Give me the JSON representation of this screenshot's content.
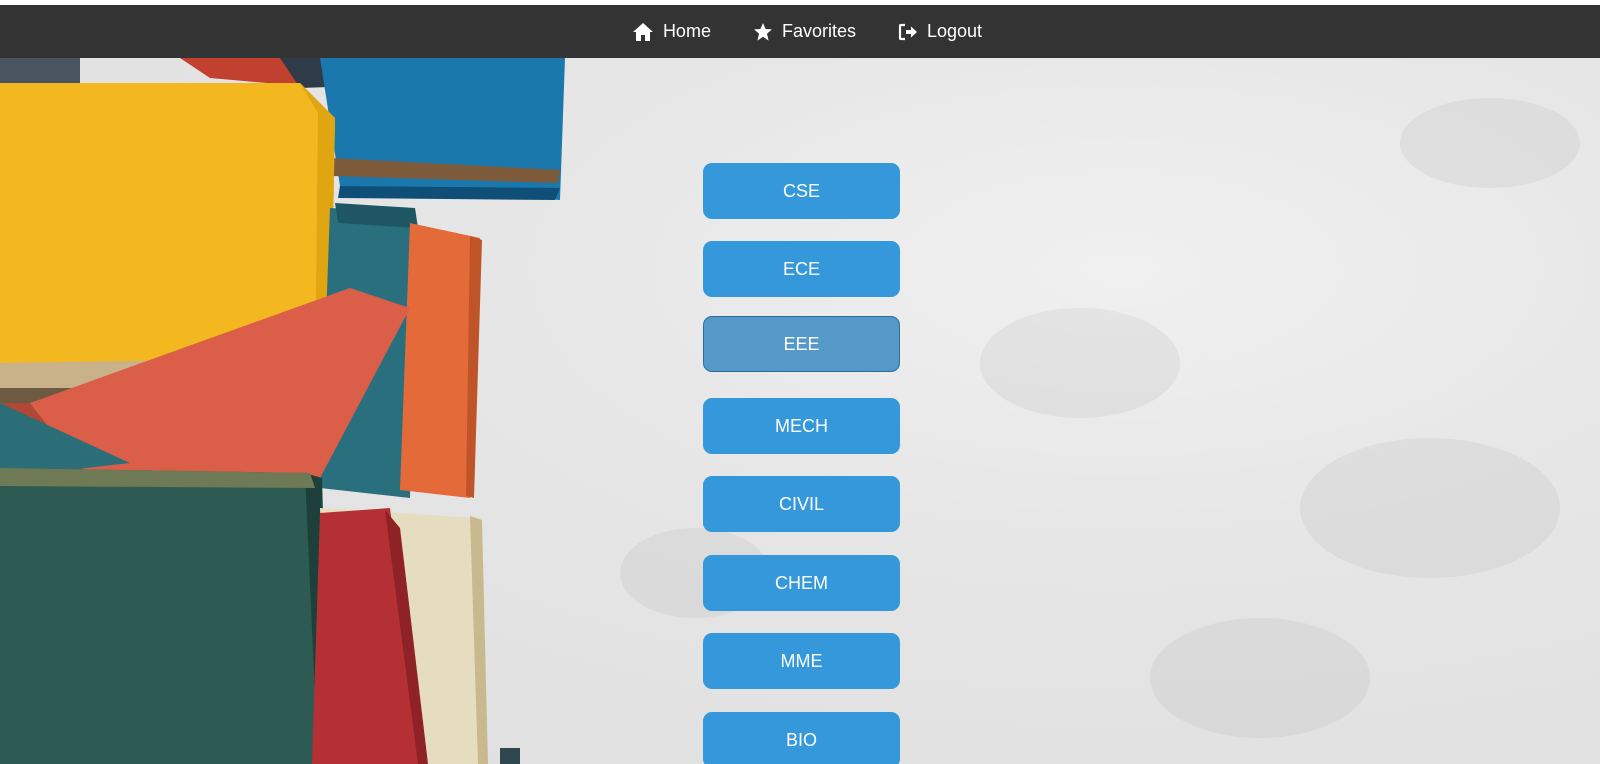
{
  "nav": {
    "items": [
      {
        "label": "Home",
        "icon": "home-icon"
      },
      {
        "label": "Favorites",
        "icon": "star-icon"
      },
      {
        "label": "Logout",
        "icon": "logout-icon"
      }
    ]
  },
  "departments": [
    {
      "label": "CSE"
    },
    {
      "label": "ECE"
    },
    {
      "label": "EEE",
      "state": "hover"
    },
    {
      "label": "MECH"
    },
    {
      "label": "CIVIL"
    },
    {
      "label": "CHEM"
    },
    {
      "label": "MME"
    },
    {
      "label": "BIO"
    }
  ],
  "colors": {
    "navbar": "#333333",
    "button": "#3498db",
    "button_hover": "#5499c7",
    "background": "#e6e6e6"
  }
}
